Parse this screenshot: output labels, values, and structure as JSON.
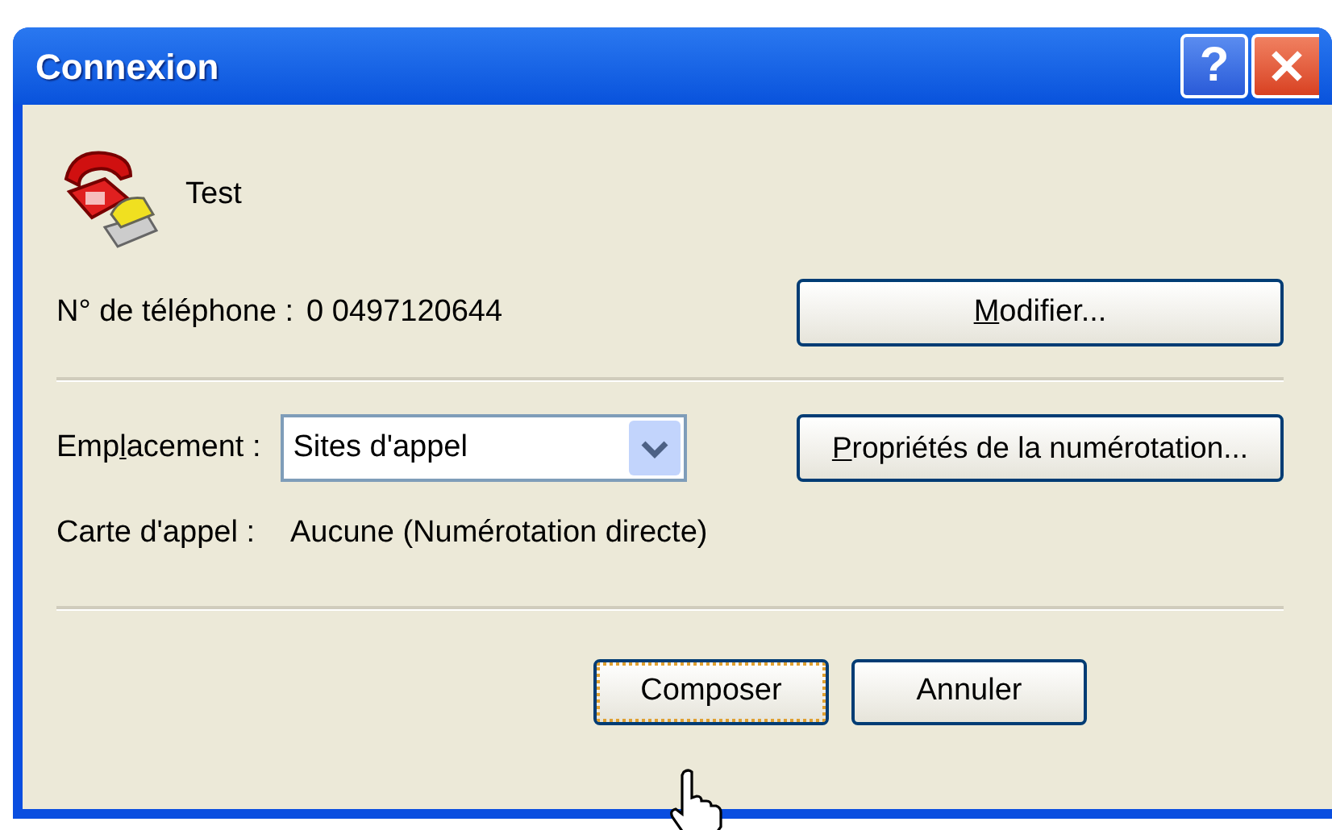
{
  "window": {
    "title": "Connexion",
    "title_buttons": [
      {
        "kind": "help",
        "label": "?"
      },
      {
        "kind": "close"
      }
    ]
  },
  "connection": {
    "name": "Test"
  },
  "phone": {
    "label": "N° de téléphone :",
    "value": "0 0497120644",
    "button": {
      "key": "M",
      "after": "odifier..."
    }
  },
  "location": {
    "label": {
      "before": "Emp",
      "key": "l",
      "after": "acement :"
    },
    "value": "Sites d'appel",
    "button": {
      "key": "P",
      "after": "ropriétés de la numérotation..."
    }
  },
  "calling_card": {
    "label": "Carte d'appel :",
    "value": "Aucune (Numérotation directe)"
  },
  "buttons": [
    {
      "label": "Composer",
      "selected": true
    },
    {
      "label": "Annuler",
      "selected": false
    }
  ]
}
